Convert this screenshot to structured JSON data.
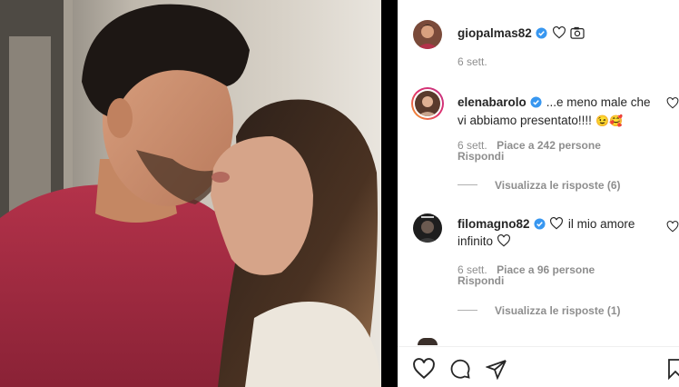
{
  "post": {
    "author": "giopalmas82",
    "date": "6 sett."
  },
  "comments": [
    {
      "user": "elenabarolo",
      "text_line1": "...e meno male che",
      "text_line2": "vi abbiamo presentato!!!!",
      "emoji": "😉🥰",
      "time": "6 sett.",
      "likes": "Piace a 242 persone",
      "reply": "Rispondi",
      "view_replies": "Visualizza le risposte (6)"
    },
    {
      "user": "filomagno82",
      "text_line1": "il mio amore",
      "text_line2": "infinito",
      "time": "6 sett.",
      "likes": "Piace a 96 persone",
      "reply": "Rispondi",
      "view_replies": "Visualizza le risposte (1)"
    }
  ],
  "icons": [
    "verified-badge-icon",
    "heart-icon",
    "camera-emoji-icon",
    "comment-icon",
    "share-icon",
    "bookmark-icon"
  ],
  "colors": {
    "verified": "#3897f0",
    "text": "#262626",
    "meta": "#8e8e8e"
  }
}
